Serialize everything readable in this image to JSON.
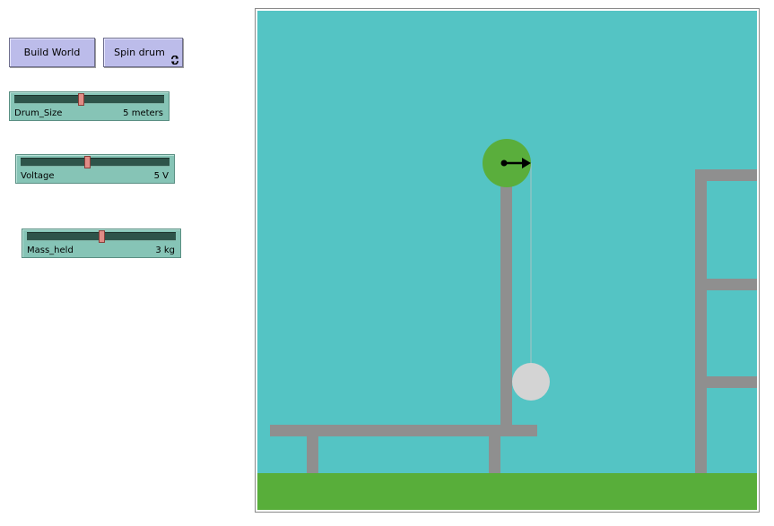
{
  "buttons": {
    "build_world": "Build World",
    "spin_drum": "Spin drum"
  },
  "sliders": {
    "drum_size": {
      "label": "Drum_Size",
      "value": "5 meters",
      "position": 0.5
    },
    "voltage": {
      "label": "Voltage",
      "value": "5 V",
      "position": 0.5
    },
    "mass_held": {
      "label": "Mass_held",
      "value": "3 kg",
      "position": 0.5
    }
  },
  "icons": {
    "forever": "forever-loop-icon",
    "drum_arrow": "right-arrow-icon"
  },
  "colors": {
    "button_bg": "#bcbcea",
    "slider_bg": "#86c4b6",
    "sky": "#54c4c4",
    "ground": "#58ae3a",
    "structure": "#8f8f8f",
    "drum": "#5aae3c",
    "mass": "#d4d4d4"
  }
}
